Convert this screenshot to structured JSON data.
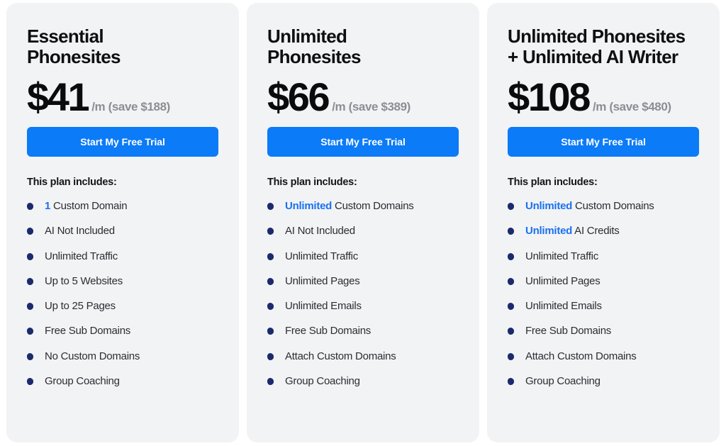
{
  "theme": {
    "page_background": "#ffffff",
    "card_background": "#f2f3f5",
    "accent_blue": "#0b7bf7",
    "highlight_blue": "#1a72f0",
    "bullet_navy": "#1b2a6b",
    "price_suffix_gray": "#8b8e94",
    "title_black": "#0f0f10"
  },
  "plans": [
    {
      "title": "Essential\nPhonesites",
      "price": "$41",
      "price_suffix": "/m (save $188)",
      "cta_label": "Start My Free Trial",
      "includes_label": "This plan includes:",
      "features": [
        {
          "highlight": "1",
          "text": " Custom Domain"
        },
        {
          "highlight": "",
          "text": "AI Not Included"
        },
        {
          "highlight": "",
          "text": "Unlimited Traffic"
        },
        {
          "highlight": "",
          "text": "Up to 5 Websites"
        },
        {
          "highlight": "",
          "text": "Up to 25 Pages"
        },
        {
          "highlight": "",
          "text": "Free Sub Domains"
        },
        {
          "highlight": "",
          "text": "No Custom Domains"
        },
        {
          "highlight": "",
          "text": "Group Coaching"
        }
      ]
    },
    {
      "title": "Unlimited\nPhonesites",
      "price": "$66",
      "price_suffix": "/m (save $389)",
      "cta_label": "Start My Free Trial",
      "includes_label": "This plan includes:",
      "features": [
        {
          "highlight": "Unlimited",
          "text": " Custom Domains"
        },
        {
          "highlight": "",
          "text": "AI Not Included"
        },
        {
          "highlight": "",
          "text": "Unlimited Traffic"
        },
        {
          "highlight": "",
          "text": "Unlimited Pages"
        },
        {
          "highlight": "",
          "text": "Unlimited Emails"
        },
        {
          "highlight": "",
          "text": "Free Sub Domains"
        },
        {
          "highlight": "",
          "text": "Attach Custom Domains"
        },
        {
          "highlight": "",
          "text": "Group Coaching"
        }
      ]
    },
    {
      "title": "Unlimited Phonesites\n+ Unlimited AI Writer",
      "price": "$108",
      "price_suffix": "/m (save $480)",
      "cta_label": "Start My Free Trial",
      "includes_label": "This plan includes:",
      "features": [
        {
          "highlight": "Unlimited",
          "text": " Custom Domains"
        },
        {
          "highlight": "Unlimited",
          "text": " AI Credits"
        },
        {
          "highlight": "",
          "text": "Unlimited Traffic"
        },
        {
          "highlight": "",
          "text": "Unlimited Pages"
        },
        {
          "highlight": "",
          "text": "Unlimited Emails"
        },
        {
          "highlight": "",
          "text": "Free Sub Domains"
        },
        {
          "highlight": "",
          "text": "Attach Custom Domains"
        },
        {
          "highlight": "",
          "text": "Group Coaching"
        }
      ]
    }
  ]
}
